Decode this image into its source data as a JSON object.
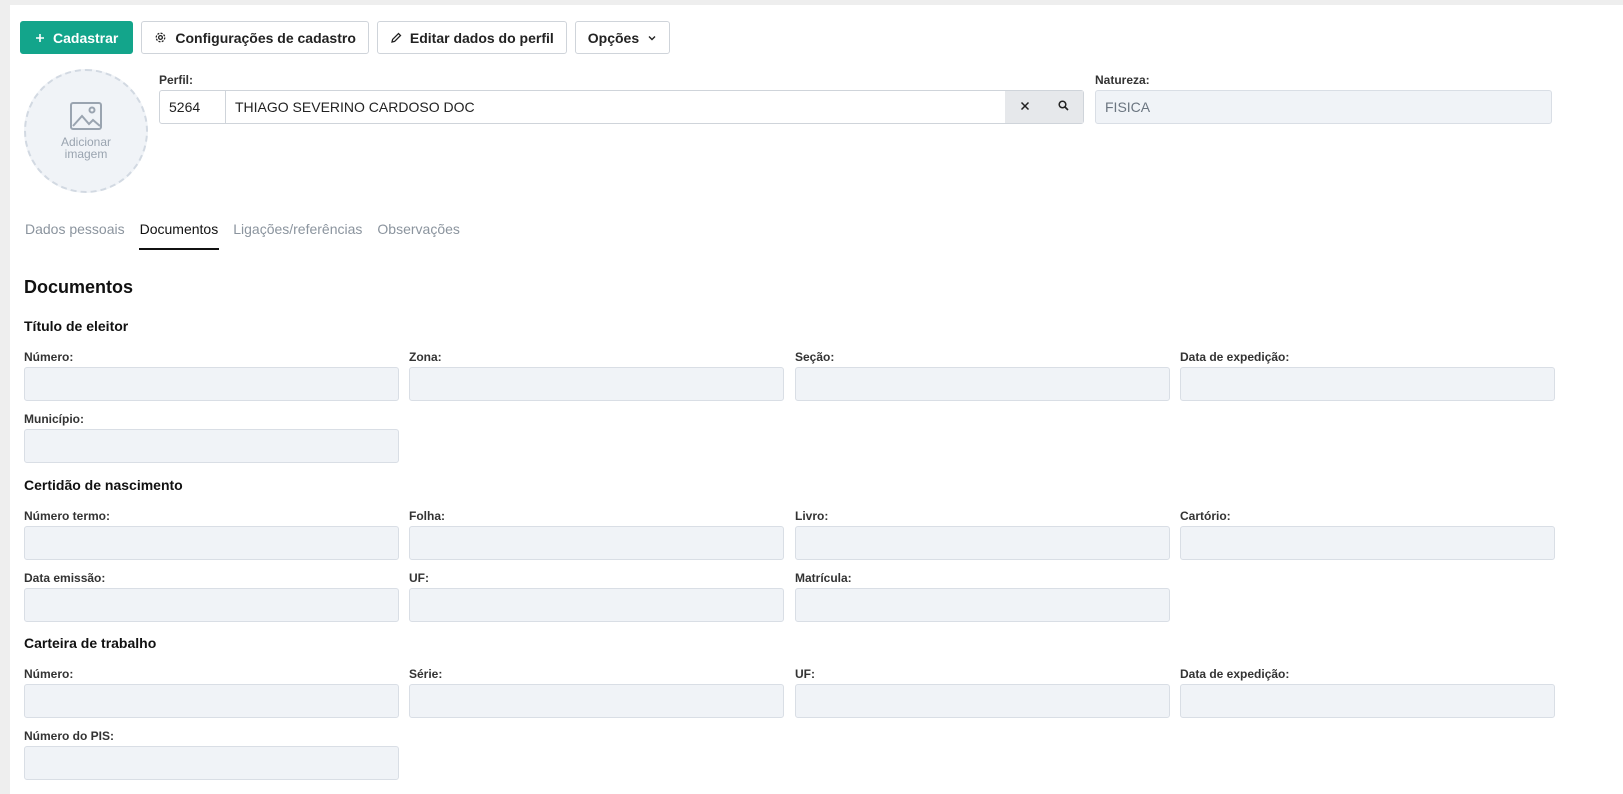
{
  "toolbar": {
    "cadastrar_label": "Cadastrar",
    "config_label": "Configurações de cadastro",
    "editar_label": "Editar dados do perfil",
    "opcoes_label": "Opções"
  },
  "avatar": {
    "label": "Adicionar imagem"
  },
  "profile": {
    "label": "Perfil:",
    "code": "5264",
    "name": "THIAGO SEVERINO CARDOSO DOC"
  },
  "natureza": {
    "label": "Natureza:",
    "value": "FISICA"
  },
  "tabs": [
    {
      "label": "Dados pessoais",
      "active": false
    },
    {
      "label": "Documentos",
      "active": true
    },
    {
      "label": "Ligações/referências",
      "active": false
    },
    {
      "label": "Observações",
      "active": false
    }
  ],
  "documents": {
    "title": "Documentos",
    "titulo_eleitor": {
      "title": "Título de eleitor",
      "fields": [
        "Número:",
        "Zona:",
        "Seção:",
        "Data de expedição:",
        "Município:"
      ]
    },
    "certidao": {
      "title": "Certidão de nascimento",
      "fields": [
        "Número termo:",
        "Folha:",
        "Livro:",
        "Cartório:",
        "Data emissão:",
        "UF:",
        "Matrícula:"
      ]
    },
    "carteira": {
      "title": "Carteira de trabalho",
      "fields": [
        "Número:",
        "Série:",
        "UF:",
        "Data de expedição:",
        "Número do PIS:"
      ]
    }
  },
  "colors": {
    "primary": "#13a58b",
    "input_bg": "#f0f3f7",
    "border": "#cfd4da"
  }
}
